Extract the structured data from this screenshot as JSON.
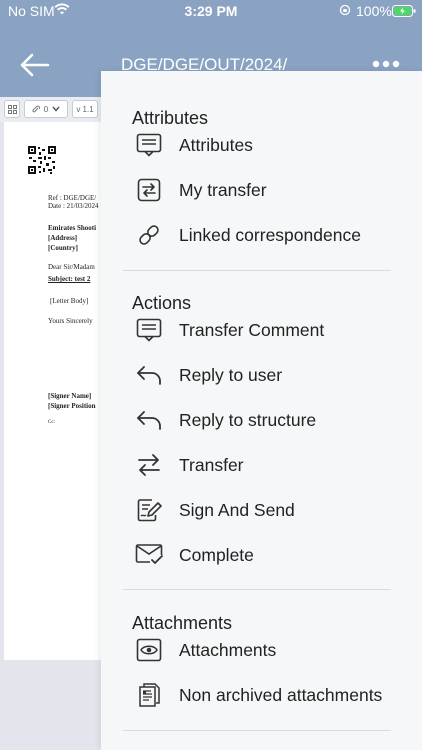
{
  "status_bar": {
    "carrier": "No SIM",
    "time": "3:29 PM",
    "battery": "100%"
  },
  "header": {
    "title": "DGE/DGE/OUT/2024/"
  },
  "doc_toolbar": {
    "attachments_count": "0",
    "version": "v 1.1"
  },
  "document": {
    "ref": "Ref    : DGE/DGE/",
    "date": "Date   : 21/03/2024",
    "recipient": "Emirates Shooti",
    "address": "[Address]",
    "country": "[Country]",
    "salutation": "Dear Sir/Madam",
    "subject": "Subject: test 2",
    "body": "[Letter Body]",
    "closing": "Yours Sincerely",
    "signer_name": "[Signer Name]",
    "signer_position": "[Signer Position",
    "cc": "Cc:"
  },
  "menu": {
    "sections": [
      {
        "title": "Attributes",
        "items": [
          {
            "label": "Attributes",
            "icon": "attributes-icon"
          },
          {
            "label": "My transfer",
            "icon": "my-transfer-icon"
          },
          {
            "label": "Linked correspondence",
            "icon": "link-icon"
          }
        ]
      },
      {
        "title": "Actions",
        "items": [
          {
            "label": "Transfer Comment",
            "icon": "comment-icon"
          },
          {
            "label": "Reply to user",
            "icon": "reply-icon"
          },
          {
            "label": "Reply to structure",
            "icon": "reply-icon"
          },
          {
            "label": "Transfer",
            "icon": "transfer-icon"
          },
          {
            "label": "Sign And Send",
            "icon": "sign-icon"
          },
          {
            "label": "Complete",
            "icon": "complete-icon"
          }
        ]
      },
      {
        "title": "Attachments",
        "items": [
          {
            "label": "Attachments",
            "icon": "eye-icon"
          },
          {
            "label": "Non archived attachments",
            "icon": "document-icon"
          }
        ]
      }
    ]
  },
  "colors": {
    "header": "#8aa3c3",
    "menu_bg": "#f6f7f8",
    "battery": "#4cd964"
  }
}
